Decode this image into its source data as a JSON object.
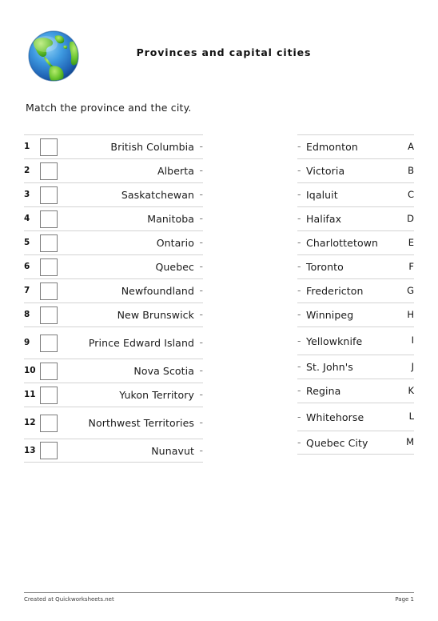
{
  "header": {
    "title": "Provinces and capital cities",
    "globe_icon": "globe-icon"
  },
  "instruction": "Match the province and the city.",
  "left_column": {
    "items": [
      {
        "number": "1",
        "label": "British Columbia",
        "dash": "-"
      },
      {
        "number": "2",
        "label": "Alberta",
        "dash": "-"
      },
      {
        "number": "3",
        "label": "Saskatchewan",
        "dash": "-"
      },
      {
        "number": "4",
        "label": "Manitoba",
        "dash": "-"
      },
      {
        "number": "5",
        "label": "Ontario",
        "dash": "-"
      },
      {
        "number": "6",
        "label": "Quebec",
        "dash": "-"
      },
      {
        "number": "7",
        "label": "Newfoundland",
        "dash": "-"
      },
      {
        "number": "8",
        "label": "New Brunswick",
        "dash": "-"
      },
      {
        "number": "9",
        "label": "Prince Edward Island",
        "dash": "-"
      },
      {
        "number": "10",
        "label": "Nova Scotia",
        "dash": "-"
      },
      {
        "number": "11",
        "label": "Yukon Territory",
        "dash": "-"
      },
      {
        "number": "12",
        "label": "Northwest Territories",
        "dash": "-"
      },
      {
        "number": "13",
        "label": "Nunavut",
        "dash": "-"
      }
    ]
  },
  "right_column": {
    "items": [
      {
        "letter": "A",
        "label": "Edmonton",
        "dash": "-"
      },
      {
        "letter": "B",
        "label": "Victoria",
        "dash": "-"
      },
      {
        "letter": "C",
        "label": "Iqaluit",
        "dash": "-"
      },
      {
        "letter": "D",
        "label": "Halifax",
        "dash": "-"
      },
      {
        "letter": "E",
        "label": "Charlottetown",
        "dash": "-"
      },
      {
        "letter": "F",
        "label": "Toronto",
        "dash": "-"
      },
      {
        "letter": "G",
        "label": "Fredericton",
        "dash": "-"
      },
      {
        "letter": "H",
        "label": "Winnipeg",
        "dash": "-"
      },
      {
        "letter": "I",
        "label": "Yellowknife",
        "dash": "-"
      },
      {
        "letter": "J",
        "label": "St.  John's",
        "dash": "-"
      },
      {
        "letter": "K",
        "label": "Regina",
        "dash": "-"
      },
      {
        "letter": "L",
        "label": "Whitehorse",
        "dash": "-"
      },
      {
        "letter": "M",
        "label": "Quebec City",
        "dash": "-"
      }
    ]
  },
  "footer": {
    "credit": "Created at Quickworksheets.net",
    "page": "Page 1"
  },
  "colors": {
    "rule": "#d3d3d3",
    "footer_rule": "#8a8a8a",
    "checkbox_border": "#7d7d7d",
    "globe_ocean": "#2f7fd0",
    "globe_land": "#5cc22e",
    "text": "#1a1a1a"
  }
}
